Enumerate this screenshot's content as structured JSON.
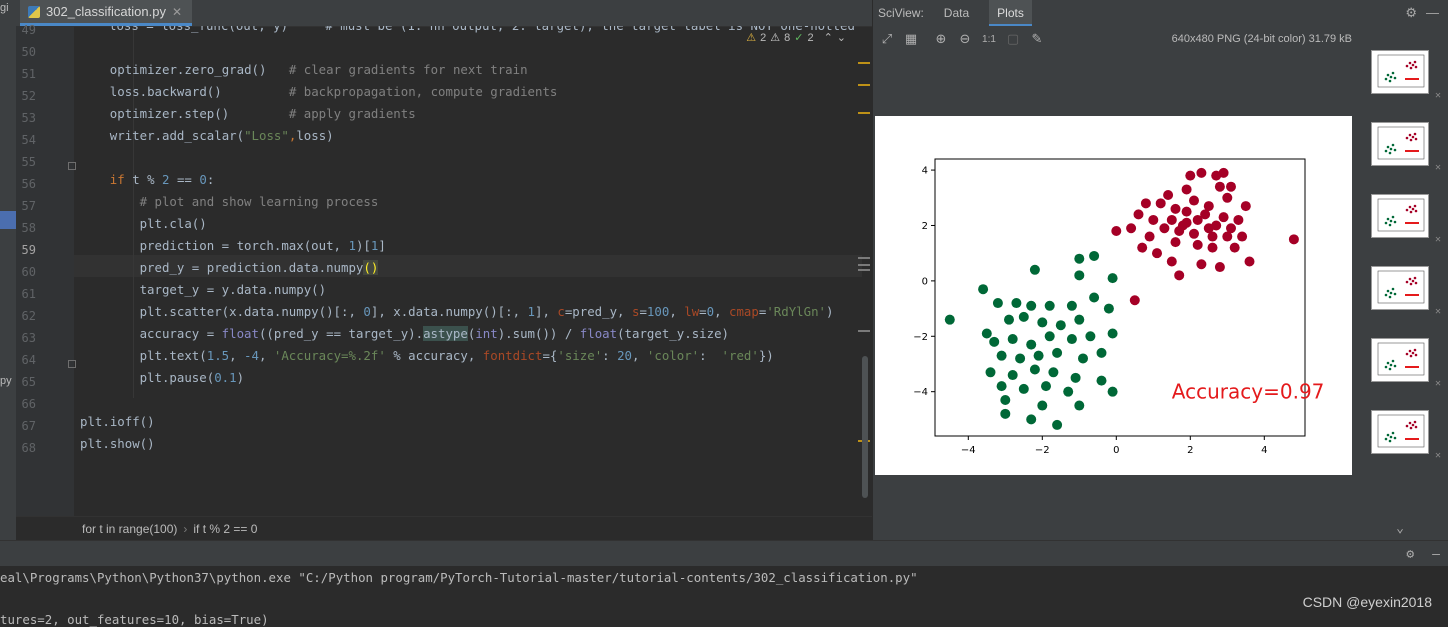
{
  "left_strip": {
    "label_top": "gi",
    "label_bottom": "py"
  },
  "editor": {
    "tab": {
      "filename": "302_classification.py",
      "icon": "python-file-icon"
    },
    "inspections": {
      "warnings": "2",
      "weak_warnings": "8",
      "typos": "2"
    },
    "top_partial_line": "loss = loss_func(out, y)     # must be (1. nn output, 2. target), the target label is NOT one-hotted",
    "line_numbers": [
      "49",
      "50",
      "51",
      "52",
      "53",
      "54",
      "55",
      "56",
      "57",
      "58",
      "59",
      "60",
      "61",
      "62",
      "63",
      "64",
      "65",
      "66",
      "67",
      "68"
    ],
    "current_line": "59",
    "lines": [
      {
        "n": "50",
        "indent": 4,
        "segs": [
          {
            "t": "optimizer.zero_grad()   ",
            "c": ""
          },
          {
            "t": "# clear gradients for next train",
            "c": "cmt"
          }
        ]
      },
      {
        "n": "51",
        "indent": 4,
        "segs": [
          {
            "t": "loss.backward()         ",
            "c": ""
          },
          {
            "t": "# backpropagation, compute gradients",
            "c": "cmt"
          }
        ]
      },
      {
        "n": "52",
        "indent": 4,
        "segs": [
          {
            "t": "optimizer.step()        ",
            "c": ""
          },
          {
            "t": "# apply gradients",
            "c": "cmt"
          }
        ]
      },
      {
        "n": "53",
        "indent": 4,
        "segs": [
          {
            "t": "writer.add_scalar(",
            "c": ""
          },
          {
            "t": "\"Loss\"",
            "c": "str"
          },
          {
            "t": ",",
            "c": "kw"
          },
          {
            "t": "loss)",
            "c": ""
          }
        ]
      },
      {
        "n": "54",
        "indent": 0,
        "segs": []
      },
      {
        "n": "55",
        "indent": 4,
        "segs": [
          {
            "t": "if ",
            "c": "kw"
          },
          {
            "t": "t % ",
            "c": ""
          },
          {
            "t": "2",
            "c": "num"
          },
          {
            "t": " == ",
            "c": ""
          },
          {
            "t": "0",
            "c": "num"
          },
          {
            "t": ":",
            "c": ""
          }
        ]
      },
      {
        "n": "56",
        "indent": 8,
        "segs": [
          {
            "t": "# plot and show learning process",
            "c": "cmt"
          }
        ]
      },
      {
        "n": "57",
        "indent": 8,
        "segs": [
          {
            "t": "plt.cla()",
            "c": ""
          }
        ]
      },
      {
        "n": "58",
        "indent": 8,
        "segs": [
          {
            "t": "prediction = torch.max(out, ",
            "c": ""
          },
          {
            "t": "1",
            "c": "num"
          },
          {
            "t": ")[",
            "c": ""
          },
          {
            "t": "1",
            "c": "num"
          },
          {
            "t": "]",
            "c": ""
          }
        ]
      },
      {
        "n": "59",
        "indent": 8,
        "segs": [
          {
            "t": "pred_y = prediction.data.numpy",
            "c": ""
          },
          {
            "t": "()",
            "c": "hlb"
          }
        ]
      },
      {
        "n": "60",
        "indent": 8,
        "segs": [
          {
            "t": "target_y = y.data.numpy()",
            "c": ""
          }
        ]
      },
      {
        "n": "61",
        "indent": 8,
        "segs": [
          {
            "t": "plt.scatter(x.data.numpy()[:, ",
            "c": ""
          },
          {
            "t": "0",
            "c": "num"
          },
          {
            "t": "], x.data.numpy()[:, ",
            "c": ""
          },
          {
            "t": "1",
            "c": "num"
          },
          {
            "t": "], ",
            "c": ""
          },
          {
            "t": "c",
            "c": "kwarg"
          },
          {
            "t": "=pred_y, ",
            "c": ""
          },
          {
            "t": "s",
            "c": "kwarg"
          },
          {
            "t": "=",
            "c": ""
          },
          {
            "t": "100",
            "c": "num"
          },
          {
            "t": ", ",
            "c": ""
          },
          {
            "t": "lw",
            "c": "kwarg"
          },
          {
            "t": "=",
            "c": ""
          },
          {
            "t": "0",
            "c": "num"
          },
          {
            "t": ", ",
            "c": ""
          },
          {
            "t": "cmap",
            "c": "kwarg"
          },
          {
            "t": "=",
            "c": ""
          },
          {
            "t": "'RdYlGn'",
            "c": "str"
          },
          {
            "t": ")",
            "c": ""
          }
        ]
      },
      {
        "n": "62",
        "indent": 8,
        "segs": [
          {
            "t": "accuracy = ",
            "c": ""
          },
          {
            "t": "float",
            "c": "bi"
          },
          {
            "t": "((pred_y == target_y).",
            "c": ""
          },
          {
            "t": "astype",
            "c": "hl"
          },
          {
            "t": "(",
            "c": ""
          },
          {
            "t": "int",
            "c": "bi"
          },
          {
            "t": ").sum()) / ",
            "c": ""
          },
          {
            "t": "float",
            "c": "bi"
          },
          {
            "t": "(target_y.size)",
            "c": ""
          }
        ]
      },
      {
        "n": "63",
        "indent": 8,
        "segs": [
          {
            "t": "plt.text(",
            "c": ""
          },
          {
            "t": "1.5",
            "c": "num"
          },
          {
            "t": ", ",
            "c": ""
          },
          {
            "t": "-4",
            "c": "num"
          },
          {
            "t": ", ",
            "c": ""
          },
          {
            "t": "'Accuracy=%.2f'",
            "c": "str"
          },
          {
            "t": " % accuracy, ",
            "c": ""
          },
          {
            "t": "fontdict",
            "c": "kwarg"
          },
          {
            "t": "={",
            "c": ""
          },
          {
            "t": "'size'",
            "c": "str"
          },
          {
            "t": ": ",
            "c": ""
          },
          {
            "t": "20",
            "c": "num"
          },
          {
            "t": ", ",
            "c": ""
          },
          {
            "t": "'color'",
            "c": "str"
          },
          {
            "t": ":  ",
            "c": ""
          },
          {
            "t": "'red'",
            "c": "str"
          },
          {
            "t": "})",
            "c": ""
          }
        ]
      },
      {
        "n": "64",
        "indent": 8,
        "segs": [
          {
            "t": "plt.pause(",
            "c": ""
          },
          {
            "t": "0.1",
            "c": "num"
          },
          {
            "t": ")",
            "c": ""
          }
        ]
      },
      {
        "n": "65",
        "indent": 0,
        "segs": []
      },
      {
        "n": "66",
        "indent": 0,
        "segs": [
          {
            "t": "plt.ioff()",
            "c": ""
          }
        ]
      },
      {
        "n": "67",
        "indent": 0,
        "segs": [
          {
            "t": "plt.show()",
            "c": ""
          }
        ]
      },
      {
        "n": "68",
        "indent": 0,
        "segs": []
      }
    ],
    "breadcrumbs": [
      "for t in range(100)",
      "if t % 2 == 0"
    ]
  },
  "sciview": {
    "title": "SciView:",
    "tabs": [
      "Data",
      "Plots"
    ],
    "active_tab": "Plots",
    "image_info": "640x480 PNG (24-bit color) 31.79 kB",
    "toolbar_icons": [
      "fit-screen-icon",
      "grid-icon",
      "zoom-in-icon",
      "zoom-out-icon",
      "actual-size-icon",
      "background-icon",
      "color-picker-icon"
    ],
    "actual_size_label": "1:1",
    "thumbnail_count": 6
  },
  "chart_data": {
    "type": "scatter",
    "xticks": [
      "−4",
      "−2",
      "0",
      "2",
      "4"
    ],
    "yticks": [
      "4",
      "2",
      "0",
      "−2",
      "−4"
    ],
    "xlim": [
      -4.9,
      5.1
    ],
    "ylim": [
      -5.6,
      4.4
    ],
    "annotation": {
      "text": "Accuracy=0.97",
      "x": 1.5,
      "y": -4,
      "color": "#e41a1c"
    },
    "series": [
      {
        "color": "#a50026",
        "points": [
          [
            2.0,
            3.8
          ],
          [
            2.3,
            3.9
          ],
          [
            2.7,
            3.8
          ],
          [
            2.9,
            3.9
          ],
          [
            1.4,
            3.1
          ],
          [
            1.9,
            3.3
          ],
          [
            2.8,
            3.4
          ],
          [
            3.1,
            3.4
          ],
          [
            0.8,
            2.8
          ],
          [
            1.2,
            2.8
          ],
          [
            1.6,
            2.6
          ],
          [
            2.1,
            2.9
          ],
          [
            2.5,
            2.7
          ],
          [
            3.0,
            3.0
          ],
          [
            3.5,
            2.7
          ],
          [
            0.6,
            2.4
          ],
          [
            1.0,
            2.2
          ],
          [
            1.5,
            2.2
          ],
          [
            1.9,
            2.5
          ],
          [
            2.4,
            2.4
          ],
          [
            2.9,
            2.3
          ],
          [
            3.3,
            2.2
          ],
          [
            0.0,
            1.8
          ],
          [
            0.4,
            1.9
          ],
          [
            0.9,
            1.6
          ],
          [
            1.3,
            1.9
          ],
          [
            1.7,
            1.8
          ],
          [
            2.1,
            1.7
          ],
          [
            2.6,
            1.6
          ],
          [
            3.0,
            1.6
          ],
          [
            3.4,
            1.6
          ],
          [
            4.8,
            1.5
          ],
          [
            0.7,
            1.2
          ],
          [
            1.1,
            1.0
          ],
          [
            1.6,
            1.4
          ],
          [
            2.2,
            1.3
          ],
          [
            2.6,
            1.2
          ],
          [
            3.2,
            1.2
          ],
          [
            3.6,
            0.7
          ],
          [
            1.5,
            0.7
          ],
          [
            2.3,
            0.6
          ],
          [
            2.8,
            0.5
          ],
          [
            1.7,
            0.2
          ],
          [
            0.5,
            -0.7
          ],
          [
            1.9,
            2.1
          ],
          [
            2.2,
            2.2
          ],
          [
            2.7,
            2.0
          ],
          [
            1.8,
            2.0
          ],
          [
            2.5,
            1.9
          ],
          [
            3.1,
            1.9
          ]
        ]
      },
      {
        "color": "#006837",
        "points": [
          [
            -1.0,
            0.8
          ],
          [
            -0.6,
            0.9
          ],
          [
            -2.2,
            0.4
          ],
          [
            -1.0,
            0.2
          ],
          [
            -0.1,
            0.1
          ],
          [
            -3.6,
            -0.3
          ],
          [
            -3.2,
            -0.8
          ],
          [
            -2.7,
            -0.8
          ],
          [
            -2.3,
            -0.9
          ],
          [
            -1.8,
            -0.9
          ],
          [
            -1.2,
            -0.9
          ],
          [
            -0.6,
            -0.6
          ],
          [
            -4.5,
            -1.4
          ],
          [
            -3.5,
            -1.9
          ],
          [
            -2.9,
            -1.4
          ],
          [
            -2.5,
            -1.3
          ],
          [
            -2.0,
            -1.5
          ],
          [
            -1.5,
            -1.6
          ],
          [
            -1.0,
            -1.4
          ],
          [
            -0.2,
            -1.0
          ],
          [
            -3.3,
            -2.2
          ],
          [
            -2.8,
            -2.1
          ],
          [
            -2.3,
            -2.3
          ],
          [
            -1.8,
            -2.0
          ],
          [
            -1.2,
            -2.1
          ],
          [
            -0.7,
            -2.0
          ],
          [
            -0.1,
            -1.9
          ],
          [
            -3.1,
            -2.7
          ],
          [
            -2.6,
            -2.8
          ],
          [
            -2.1,
            -2.7
          ],
          [
            -1.6,
            -2.6
          ],
          [
            -0.9,
            -2.8
          ],
          [
            -0.4,
            -2.6
          ],
          [
            -3.4,
            -3.3
          ],
          [
            -2.8,
            -3.4
          ],
          [
            -2.2,
            -3.2
          ],
          [
            -1.7,
            -3.3
          ],
          [
            -1.1,
            -3.5
          ],
          [
            -0.4,
            -3.6
          ],
          [
            -3.1,
            -3.8
          ],
          [
            -2.5,
            -3.9
          ],
          [
            -1.9,
            -3.8
          ],
          [
            -1.3,
            -4.0
          ],
          [
            -0.1,
            -4.0
          ],
          [
            -3.0,
            -4.3
          ],
          [
            -2.0,
            -4.5
          ],
          [
            -1.0,
            -4.5
          ],
          [
            -3.0,
            -4.8
          ],
          [
            -1.6,
            -5.2
          ],
          [
            -2.3,
            -5.0
          ]
        ]
      }
    ]
  },
  "console": {
    "cmd": "eal\\Programs\\Python\\Python37\\python.exe \"C:/Python program/PyTorch-Tutorial-master/tutorial-contents/302_classification.py\"",
    "out_partial": "tures=2, out_features=10, bias=True)"
  },
  "watermark": "CSDN @eyexin2018"
}
